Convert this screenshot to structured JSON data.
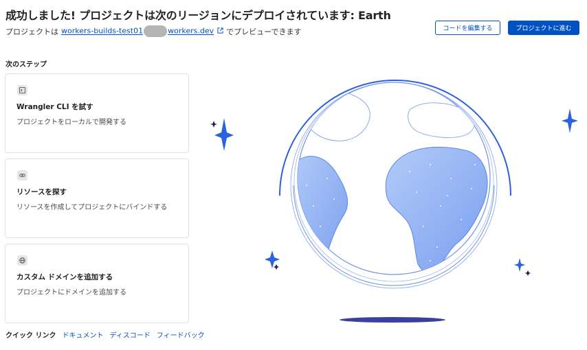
{
  "header": {
    "title": "成功しました! プロジェクトは次のリージョンにデプロイされています: Earth",
    "subtitle_prefix": "プロジェクトは",
    "url_start": "workers-builds-test01",
    "url_end": "workers.dev",
    "subtitle_suffix": "でプレビューできます",
    "edit_code_label": "コードを編集する",
    "go_to_project_label": "プロジェクトに進む"
  },
  "next_steps": {
    "heading": "次のステップ",
    "cards": [
      {
        "icon": "terminal-icon",
        "title": "Wrangler CLI を試す",
        "description": "プロジェクトをローカルで開発する"
      },
      {
        "icon": "link-icon",
        "title": "リソースを探す",
        "description": "リソースを作成してプロジェクトにバインドする"
      },
      {
        "icon": "globe-icon",
        "title": "カスタム ドメインを追加する",
        "description": "プロジェクトにドメインを追加する"
      }
    ]
  },
  "quick_links": {
    "label": "クイック リンク",
    "links": [
      "ドキュメント",
      "ディスコード",
      "フィードバック"
    ]
  },
  "colors": {
    "accent": "#0051c3",
    "globe_fill": "#8fb0f2",
    "globe_ring": "#3f6fe0",
    "star": "#2d62de"
  }
}
